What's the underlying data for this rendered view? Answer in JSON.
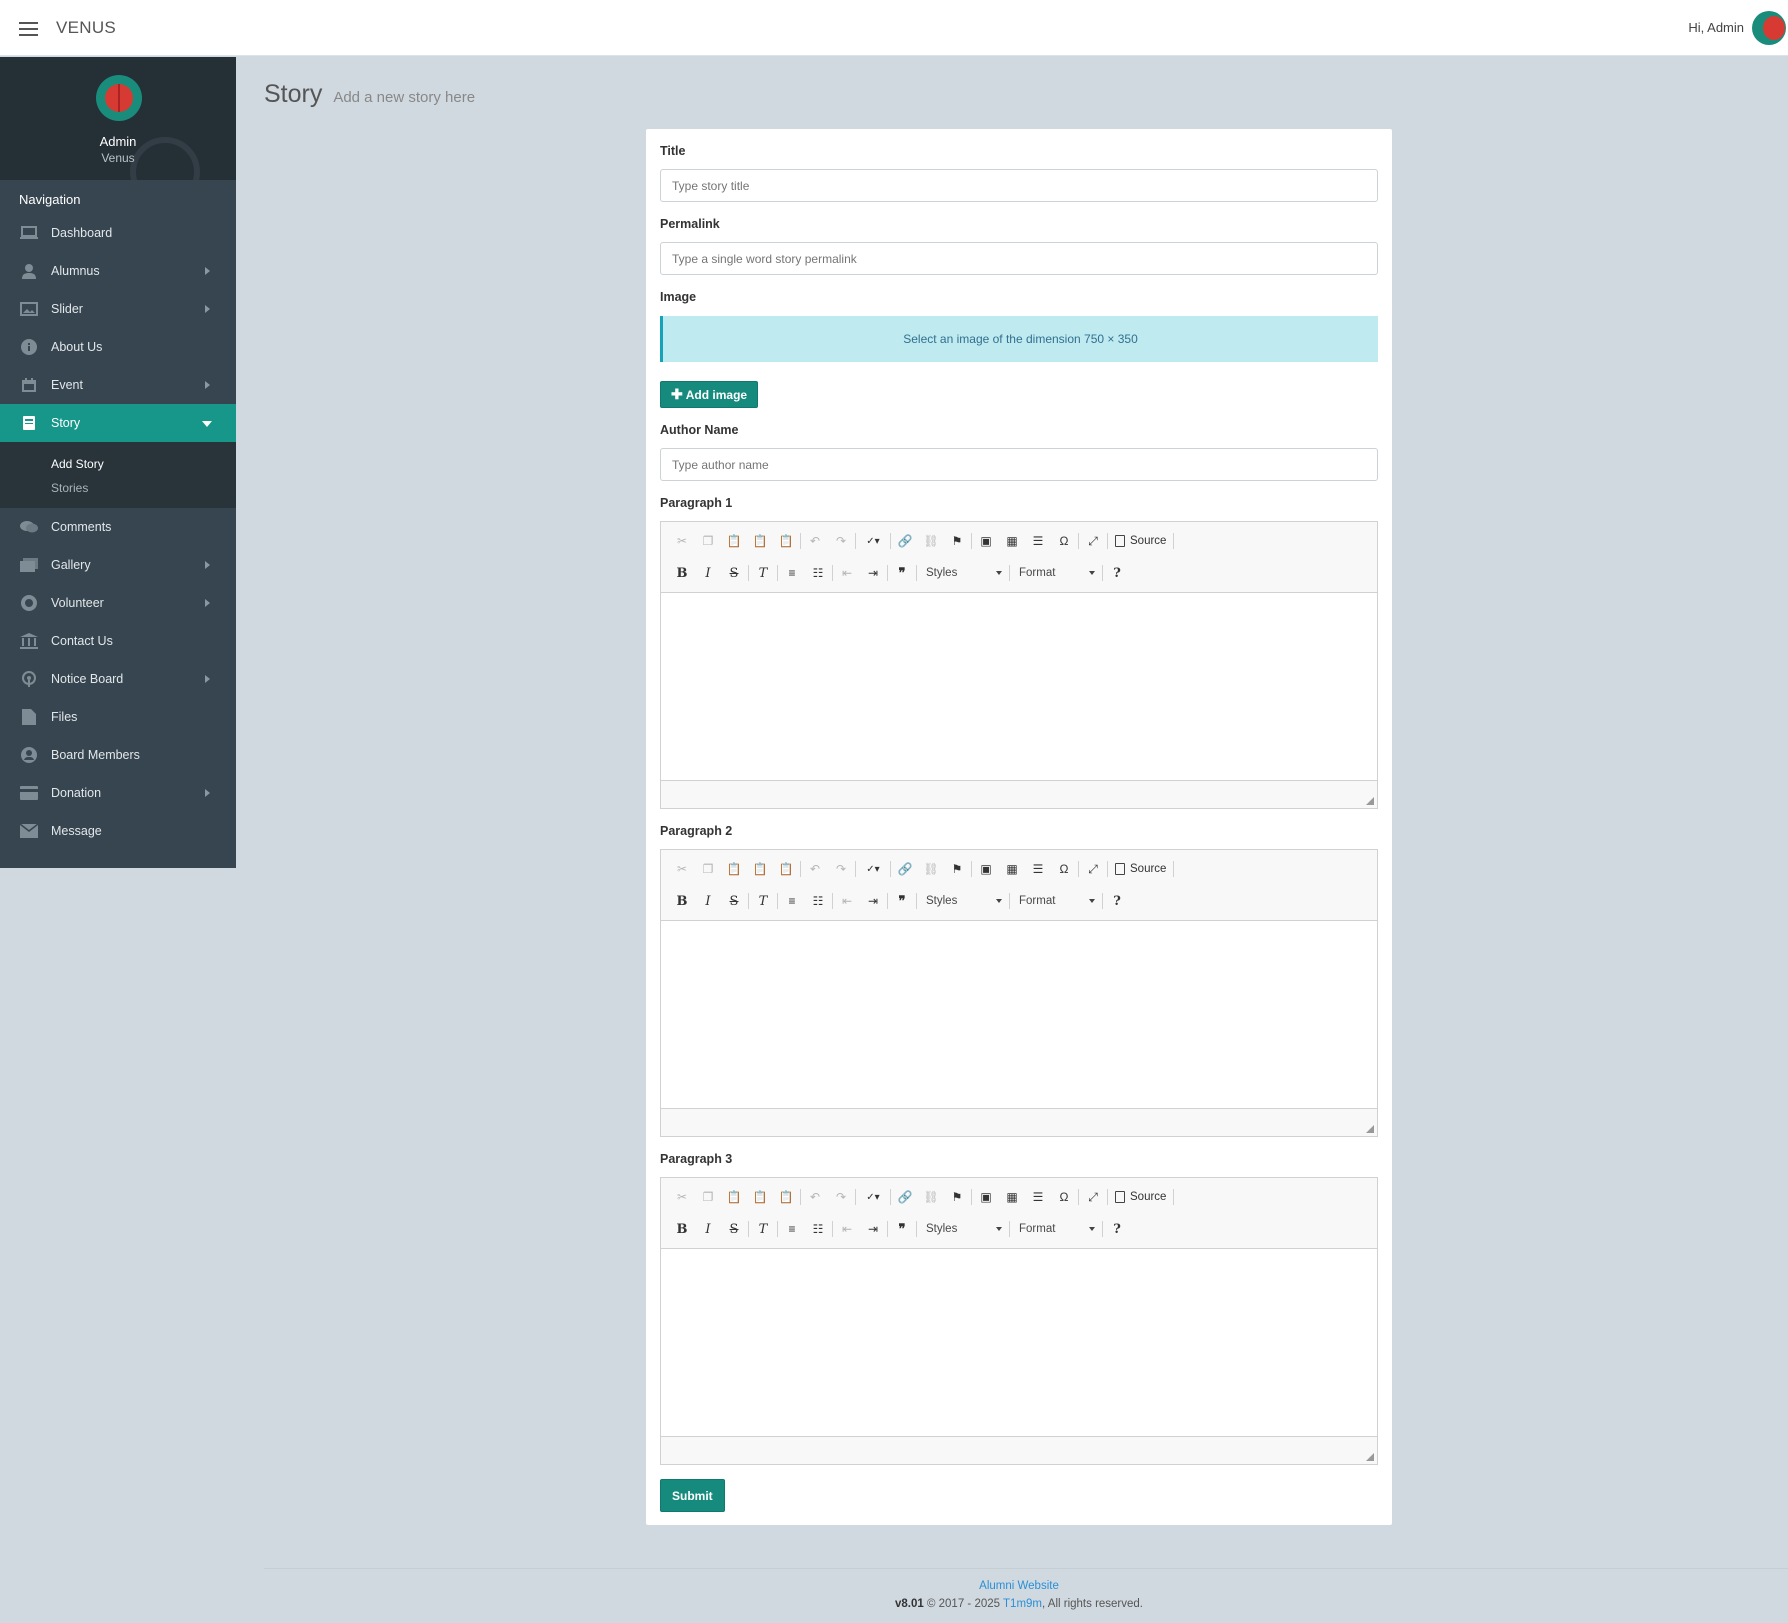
{
  "app": {
    "brand": "VENUS",
    "greeting": "Hi, Admin"
  },
  "profile": {
    "name": "Admin",
    "sub": "Venus"
  },
  "nav": {
    "heading": "Navigation",
    "items": [
      {
        "label": "Dashboard",
        "icon": "laptop-icon"
      },
      {
        "label": "Alumnus",
        "icon": "user-icon"
      },
      {
        "label": "Slider",
        "icon": "image-icon"
      },
      {
        "label": "About Us",
        "icon": "info-icon"
      },
      {
        "label": "Event",
        "icon": "calendar-icon"
      },
      {
        "label": "Story",
        "icon": "book-icon"
      },
      {
        "label": "Comments",
        "icon": "comments-icon"
      },
      {
        "label": "Gallery",
        "icon": "gallery-icon"
      },
      {
        "label": "Volunteer",
        "icon": "lifering-icon"
      },
      {
        "label": "Contact Us",
        "icon": "bank-icon"
      },
      {
        "label": "Notice Board",
        "icon": "podcast-icon"
      },
      {
        "label": "Files",
        "icon": "file-icon"
      },
      {
        "label": "Board Members",
        "icon": "user-circle-icon"
      },
      {
        "label": "Donation",
        "icon": "credit-card-icon"
      },
      {
        "label": "Message",
        "icon": "envelope-icon"
      }
    ],
    "story_sub": [
      "Add Story",
      "Stories"
    ]
  },
  "page": {
    "title": "Story",
    "subtitle": "Add a new story here"
  },
  "form": {
    "title_label": "Title",
    "title_placeholder": "Type story title",
    "permalink_label": "Permalink",
    "permalink_placeholder": "Type a single word story permalink",
    "image_label": "Image",
    "image_info": "Select an image of the dimension 750 × 350",
    "add_image": "Add image",
    "author_label": "Author Name",
    "author_placeholder": "Type author name",
    "paragraphs": [
      "Paragraph 1",
      "Paragraph 2",
      "Paragraph 3"
    ],
    "submit": "Submit"
  },
  "editor": {
    "styles": "Styles",
    "format": "Format",
    "source": "Source"
  },
  "footer": {
    "site": "Alumni Website",
    "version": "v8.01",
    "copyright": " © 2017 - 2025 ",
    "author": "T1m9m",
    "rights": ", All rights reserved."
  },
  "colors": {
    "accent": "#168b7d",
    "sidebar": "#36454f",
    "info": "#bfeaf0"
  }
}
